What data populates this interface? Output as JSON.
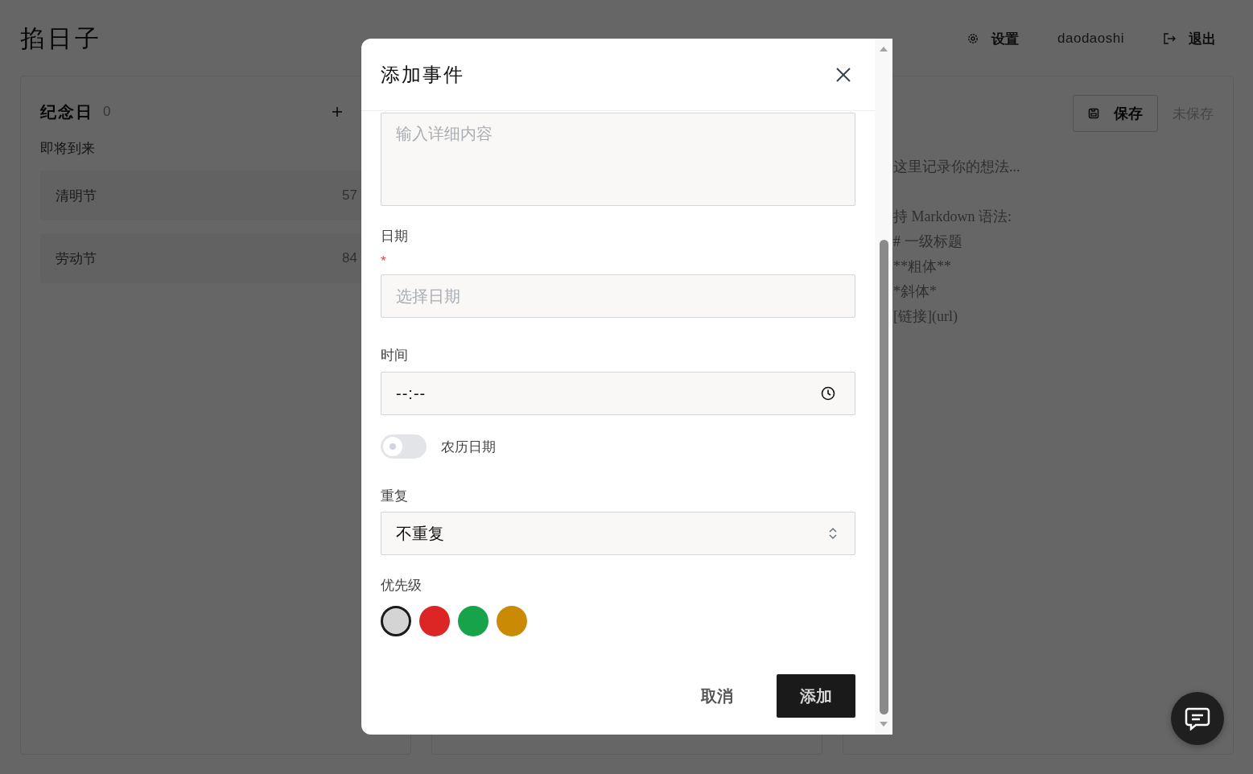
{
  "app": {
    "title": "掐日子"
  },
  "header_nav": [
    {
      "kind": "settings",
      "label": "设置"
    },
    {
      "kind": "user",
      "label": "daodaoshi"
    },
    {
      "kind": "logout",
      "label": "退出"
    }
  ],
  "anniversaries_panel": {
    "title": "纪念日",
    "count": "0",
    "section": "即将到来",
    "items": [
      {
        "name": "清明节",
        "days": "57"
      },
      {
        "name": "劳动节",
        "days": "84"
      }
    ]
  },
  "notes_panel": {
    "save_button": "保存",
    "save_status": "未保存",
    "intro": "这里记录你的想法...",
    "lines": [
      "持 Markdown 语法:",
      "# 一级标题",
      "**粗体**",
      "*斜体*",
      "[链接](url)"
    ]
  },
  "dialog": {
    "title": "添加事件",
    "details": {
      "placeholder": "输入详细内容"
    },
    "date": {
      "label": "日期",
      "required_mark": "*",
      "placeholder": "选择日期"
    },
    "time": {
      "label": "时间",
      "value": "--:--"
    },
    "lunar": {
      "label": "农历日期",
      "on": false
    },
    "repeat": {
      "label": "重复",
      "value": "不重复"
    },
    "priority": {
      "label": "优先级",
      "options": [
        {
          "color": "#d4d4d4",
          "selected": true
        },
        {
          "color": "#dc2626",
          "selected": false
        },
        {
          "color": "#16a34a",
          "selected": false
        },
        {
          "color": "#ca8a04",
          "selected": false
        }
      ]
    },
    "buttons": [
      {
        "kind": "secondary",
        "label": "取消"
      },
      {
        "kind": "primary",
        "label": "添加"
      }
    ]
  }
}
